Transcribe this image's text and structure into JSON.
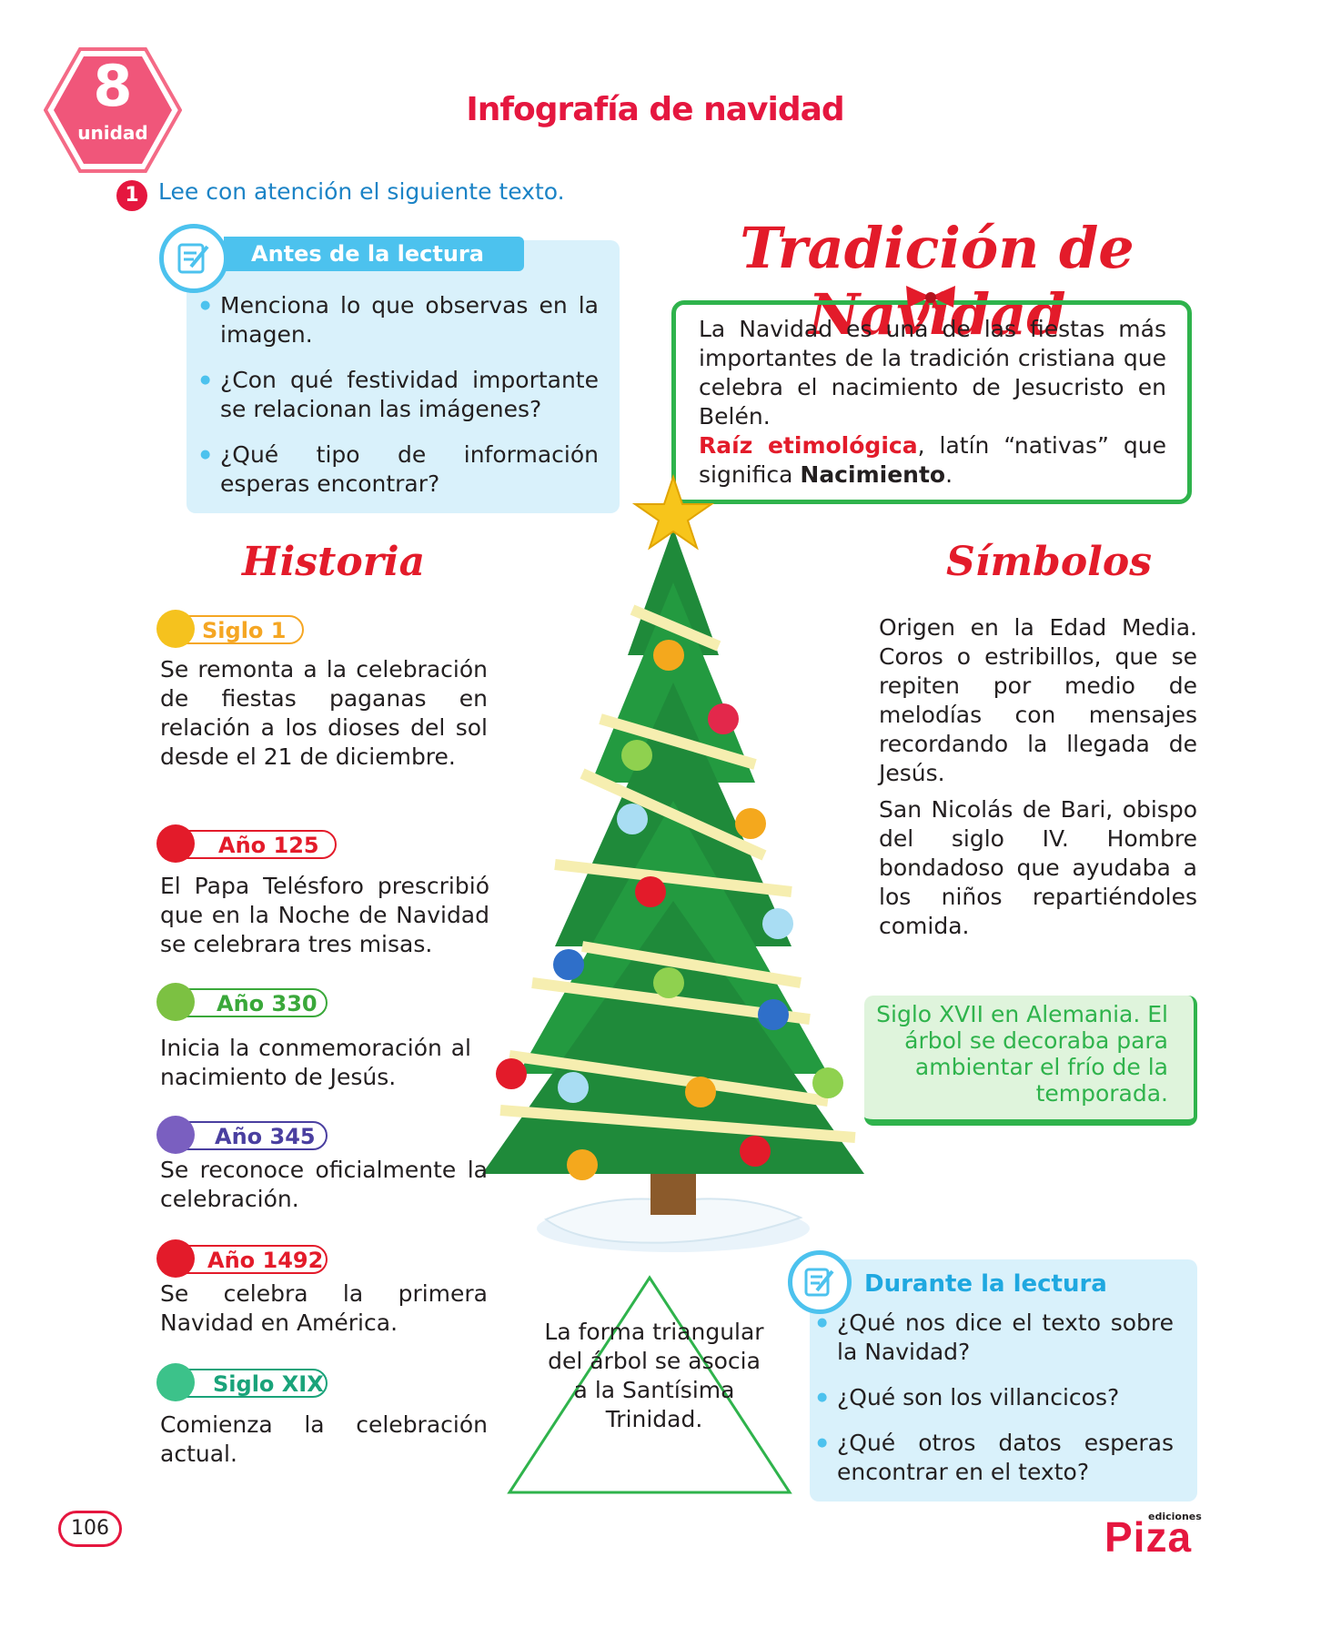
{
  "header": {
    "unit_number": "8",
    "unit_word": "unidad",
    "title": "Infografía de navidad",
    "instruction_number": "1",
    "instruction": "Lee con atención el siguiente texto."
  },
  "before_reading": {
    "title": "Antes de la lectura",
    "icon": "pencil-note-icon",
    "questions": [
      "Menciona lo que observas en la imagen.",
      "¿Con qué festividad importante se relacionan las imágenes?",
      "¿Qué tipo de información esperas encontrar?"
    ]
  },
  "main": {
    "title": "Tradición de Navidad",
    "definition": "La Navidad es una de las fiestas más importantes de la tradición cristiana que celebra el nacimiento de Jesucristo en Belén.",
    "root_label": "Raíz etimológica",
    "root_text_1": ", latín “nativas” que significa ",
    "root_word": "Nacimiento",
    "root_end": "."
  },
  "history": {
    "title": "Historia",
    "items": [
      {
        "tag": "Siglo 1",
        "color": "#f5a623",
        "text": "Se remonta a la celebración de fiestas paganas en relación a los dioses del sol desde el 21 de diciembre."
      },
      {
        "tag": "Año 125",
        "color": "#e31b2a",
        "text": "El Papa Telésforo prescribió que en la Noche de Navidad se celebrara tres misas."
      },
      {
        "tag": "Año 330",
        "color": "#3aa83a",
        "text": "Inicia la conmemoración al nacimiento de Jesús."
      },
      {
        "tag": "Año 345",
        "color": "#4a3fa0",
        "text": "Se reconoce oficialmente la celebración."
      },
      {
        "tag": "Año 1492",
        "color": "#e31b2a",
        "text": "Se celebra la primera Navidad en América."
      },
      {
        "tag": "Siglo XIX",
        "color": "#1aa37a",
        "text": "Comienza la celebración actual."
      }
    ]
  },
  "symbols": {
    "title": "Símbolos",
    "para1": "Origen en la Edad Media. Coros o estribillos, que se repiten por medio de melodías con mensajes recordando la llegada de Jesús.",
    "para2": "San Nicolás de Bari, obispo del siglo IV. Hombre bondadoso que ayudaba a los niños repartiéndoles comida.",
    "tree_note": "Siglo XVII en Alemania. El árbol se decoraba para ambientar el frío de la temporada."
  },
  "triangle_note": "La forma triangular del árbol se asocia a la Santísima Trinidad.",
  "during_reading": {
    "title": "Durante la lectura",
    "icon": "pencil-note-icon",
    "questions": [
      "¿Qué nos dice el texto sobre la Navidad?",
      "¿Qué son los villancicos?",
      "¿Qué otros datos esperas encontrar en el texto?"
    ]
  },
  "footer": {
    "page_number": "106",
    "publisher_small": "ediciones",
    "publisher": "Piza"
  },
  "colors": {
    "accent_red": "#e5173f",
    "accent_blue": "#4cc2ee",
    "accent_green": "#2fb34c"
  }
}
